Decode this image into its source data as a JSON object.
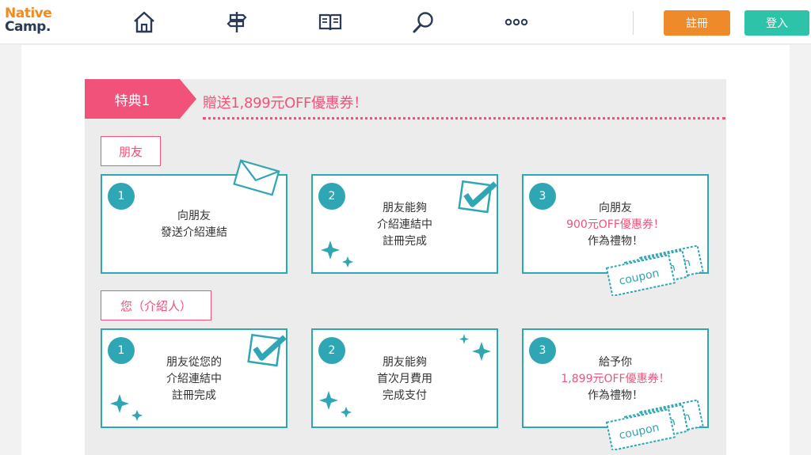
{
  "header": {
    "logo_line1": "Native",
    "logo_line2": "Camp.",
    "nav_icons": [
      "home-icon",
      "signpost-icon",
      "book-icon",
      "search-icon",
      "more-icon"
    ],
    "register_label": "註冊",
    "login_label": "登入"
  },
  "benefit": {
    "tag": "特典1",
    "headline": "贈送1,899元OFF優惠券！"
  },
  "friend_section": {
    "label": "朋友",
    "cards": [
      {
        "num": "1",
        "line1": "向朋友",
        "line2": "發送介紹連結"
      },
      {
        "num": "2",
        "line1": "朋友能夠",
        "line2": "介紹連結中",
        "line3": "註冊完成"
      },
      {
        "num": "3",
        "line1": "向朋友",
        "line2": "900元OFF優惠券！",
        "line3": "作為禮物！"
      }
    ]
  },
  "you_section": {
    "label": "您（介紹人）",
    "cards": [
      {
        "num": "1",
        "line1": "朋友從您的",
        "line2": "介紹連結中",
        "line3": "註冊完成"
      },
      {
        "num": "2",
        "line1": "朋友能夠",
        "line2": "首次月費用",
        "line3": "完成支付"
      },
      {
        "num": "3",
        "line1": "給予你",
        "line2": "1,899元OFF優惠券！",
        "line3": "作為禮物！"
      }
    ]
  },
  "coupon_text": "coupon",
  "coupon_partial": "n",
  "colors": {
    "accent_pink": "#f0527a",
    "teal": "#2ea6b4",
    "orange": "#ef8a2a",
    "green": "#2cc3a8"
  }
}
